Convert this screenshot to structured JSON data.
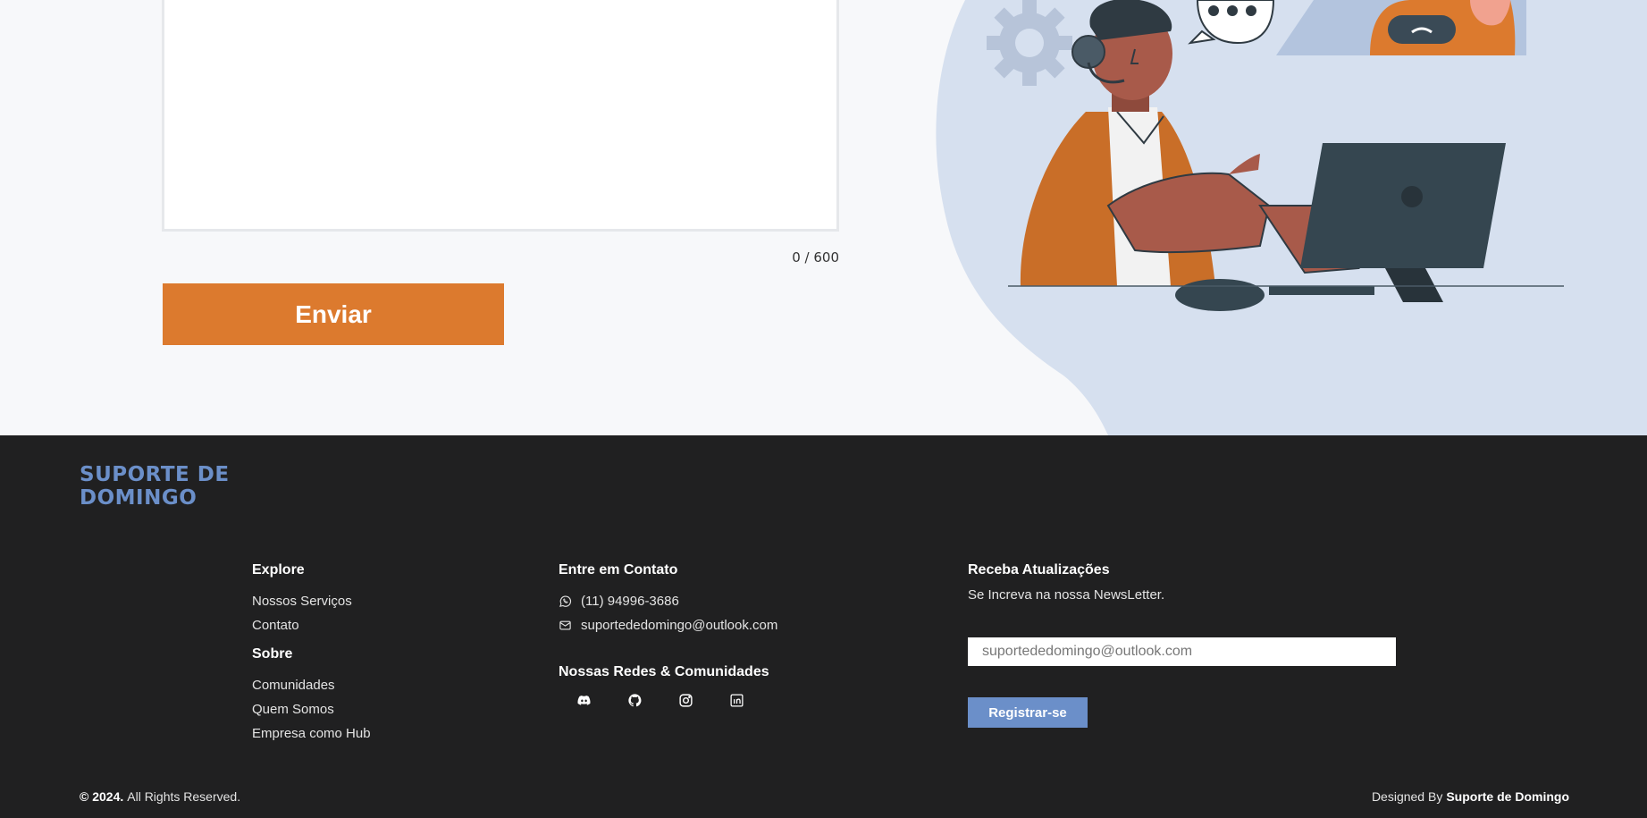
{
  "form": {
    "message_placeholder": "",
    "char_count": "0 / 600",
    "send_label": "Enviar"
  },
  "footer": {
    "brand": "SUPORTE DE DOMINGO",
    "explore": {
      "heading": "Explore",
      "links": [
        "Nossos Serviços",
        "Contato"
      ]
    },
    "sobre": {
      "heading": "Sobre",
      "links": [
        "Comunidades",
        "Quem Somos",
        "Empresa como Hub"
      ]
    },
    "contact": {
      "heading": "Entre em Contato",
      "phone": "(11) 94996-3686",
      "email": "suportededomingo@outlook.com",
      "phone_icon": "whatsapp-icon",
      "email_icon": "mail-icon"
    },
    "social": {
      "heading": "Nossas Redes & Comunidades",
      "icons": [
        "discord-icon",
        "github-icon",
        "instagram-icon",
        "linkedin-icon"
      ]
    },
    "newsletter": {
      "heading": "Receba Atualizações",
      "subtitle": "Se Increva na nossa NewsLetter.",
      "placeholder": "suportededomingo@outlook.com",
      "button_label": "Registrar-se"
    },
    "copyright_year": "© 2024.",
    "copyright_text": "All Rights Reserved.",
    "designed_prefix": "Designed By",
    "designed_name": "Suporte de Domingo"
  },
  "colors": {
    "accent_orange": "#dc7a2e",
    "accent_blue": "#6b8fc9",
    "footer_bg": "#202021",
    "page_bg": "#f7f8fa"
  }
}
